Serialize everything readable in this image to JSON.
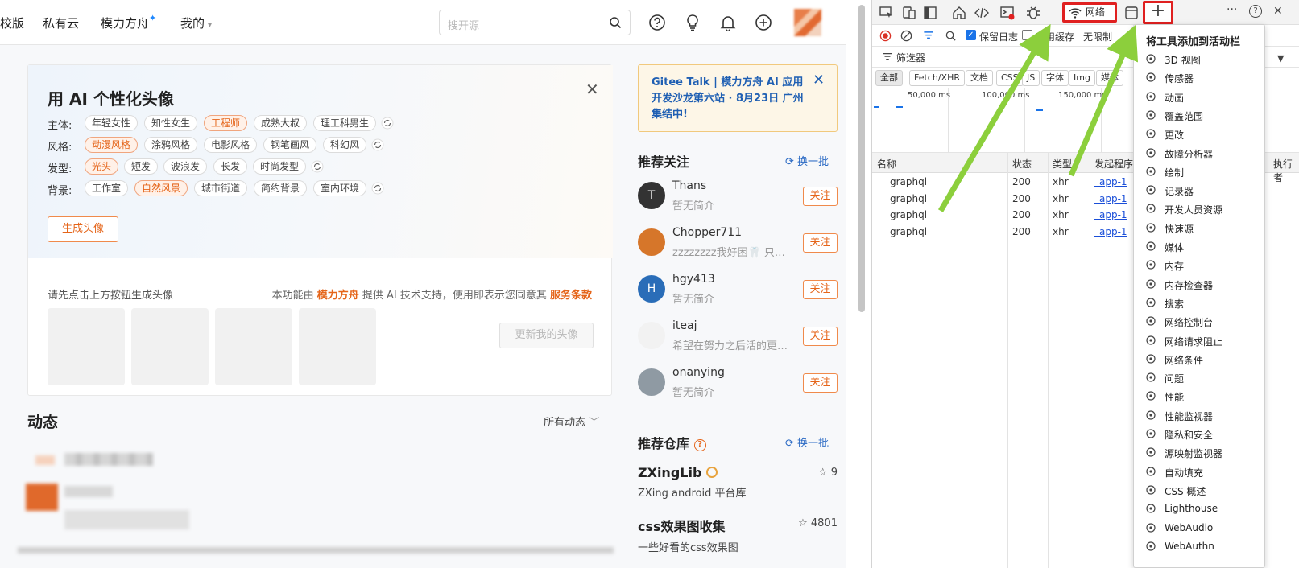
{
  "nav": {
    "items": [
      "校版",
      "私有云",
      "模力方舟",
      "我的"
    ],
    "star": "✦",
    "caret": "▾",
    "search_placeholder": "搜开源"
  },
  "ai_card": {
    "title": "用 AI 个性化头像",
    "close": "✕",
    "rows": [
      {
        "label": "主体:",
        "tags": [
          "年轻女性",
          "知性女生",
          "工程师",
          "成熟大叔",
          "理工科男生"
        ],
        "selected": 2
      },
      {
        "label": "风格:",
        "tags": [
          "动漫风格",
          "涂鸦风格",
          "电影风格",
          "钢笔画风",
          "科幻风"
        ],
        "selected": 0
      },
      {
        "label": "发型:",
        "tags": [
          "光头",
          "短发",
          "波浪发",
          "长发",
          "时尚发型"
        ],
        "selected": 0
      },
      {
        "label": "背景:",
        "tags": [
          "工作室",
          "自然风景",
          "城市街道",
          "简约背景",
          "室内环境"
        ],
        "selected": 1
      }
    ],
    "generate": "生成头像",
    "hint": "请先点击上方按钮生成头像",
    "powered_pre": "本功能由 ",
    "powered_brand": "模力方舟",
    "powered_mid": " 提供 AI 技术支持，使用即表示您同意其 ",
    "powered_terms": "服务条款",
    "update": "更新我的头像"
  },
  "feed": {
    "title": "动态",
    "filter": "所有动态",
    "filter_caret": "﹀"
  },
  "banner": {
    "text": "Gitee Talk | 模力方舟 AI 应用开发沙龙第六站 · 8月23日 广州集结中!",
    "close": "✕"
  },
  "recommend": {
    "title": "推荐关注",
    "swap": "换一批",
    "follow": "关注",
    "users": [
      {
        "name": "Thans",
        "desc": "暂无简介",
        "initial": "T",
        "color": "#333333"
      },
      {
        "name": "Chopper711",
        "desc": "zzzzzzzz我好困🦷 只想睡觉",
        "initial": "",
        "color": "#d6762a"
      },
      {
        "name": "hgy413",
        "desc": "暂无简介",
        "initial": "H",
        "color": "#2a6db8"
      },
      {
        "name": "iteaj",
        "desc": "希望在努力之后活的更好一点",
        "initial": "",
        "color": "#f2f2f2"
      },
      {
        "name": "onanying",
        "desc": "暂无简介",
        "initial": "",
        "color": "#8f9aa3"
      }
    ]
  },
  "repos": {
    "title": "推荐仓库",
    "swap": "换一批",
    "items": [
      {
        "name": "ZXingLib",
        "desc": "ZXing android 平台库",
        "stars": "9"
      },
      {
        "name": "css效果图收集",
        "desc": "一些好看的css效果图",
        "stars": "4801"
      }
    ]
  },
  "devtools": {
    "network_tab": "网络",
    "plus": "+",
    "more": "···",
    "help": "?",
    "close": "✕",
    "preserve_log": "保留日志",
    "disable_cache": "禁用缓存",
    "throttle": "无限制",
    "filter": "筛选器",
    "types": [
      "全部",
      "Fetch/XHR",
      "文档",
      "CSS",
      "JS",
      "字体",
      "Img",
      "媒体"
    ],
    "timeline": [
      "50,000 ms",
      "100,000 ms",
      "150,000 ms"
    ],
    "columns": [
      "名称",
      "状态",
      "类型",
      "发起程序",
      "执行者"
    ],
    "rows": [
      {
        "name": "graphql",
        "status": "200",
        "type": "xhr",
        "init": "_app-1"
      },
      {
        "name": "graphql",
        "status": "200",
        "type": "xhr",
        "init": "_app-1"
      },
      {
        "name": "graphql",
        "status": "200",
        "type": "xhr",
        "init": "_app-1"
      },
      {
        "name": "graphql",
        "status": "200",
        "type": "xhr",
        "init": "_app-1"
      }
    ],
    "menu_title": "将工具添加到活动栏",
    "menu": [
      {
        "label": "3D 视图",
        "icon": "cube-icon"
      },
      {
        "label": "传感器",
        "icon": "sensor-icon"
      },
      {
        "label": "动画",
        "icon": "animation-icon"
      },
      {
        "label": "覆盖范围",
        "icon": "coverage-icon"
      },
      {
        "label": "更改",
        "icon": "changes-icon"
      },
      {
        "label": "故障分析器",
        "icon": "issues-analyzer-icon"
      },
      {
        "label": "绘制",
        "icon": "paint-icon"
      },
      {
        "label": "记录器",
        "icon": "recorder-icon"
      },
      {
        "label": "开发人员资源",
        "icon": "resources-icon"
      },
      {
        "label": "快速源",
        "icon": "quick-source-icon"
      },
      {
        "label": "媒体",
        "icon": "media-icon"
      },
      {
        "label": "内存",
        "icon": "memory-icon"
      },
      {
        "label": "内存检查器",
        "icon": "memory-inspector-icon"
      },
      {
        "label": "搜索",
        "icon": "search-icon"
      },
      {
        "label": "网络控制台",
        "icon": "network-console-icon"
      },
      {
        "label": "网络请求阻止",
        "icon": "request-blocking-icon"
      },
      {
        "label": "网络条件",
        "icon": "network-conditions-icon"
      },
      {
        "label": "问题",
        "icon": "issues-icon"
      },
      {
        "label": "性能",
        "icon": "performance-icon"
      },
      {
        "label": "性能监视器",
        "icon": "performance-monitor-icon"
      },
      {
        "label": "隐私和安全",
        "icon": "privacy-icon"
      },
      {
        "label": "源映射监视器",
        "icon": "source-map-icon"
      },
      {
        "label": "自动填充",
        "icon": "autofill-icon"
      },
      {
        "label": "CSS 概述",
        "icon": "css-overview-icon"
      },
      {
        "label": "Lighthouse",
        "icon": "lighthouse-icon"
      },
      {
        "label": "WebAudio",
        "icon": "webaudio-icon"
      },
      {
        "label": "WebAuthn",
        "icon": "webauthn-icon"
      }
    ]
  }
}
